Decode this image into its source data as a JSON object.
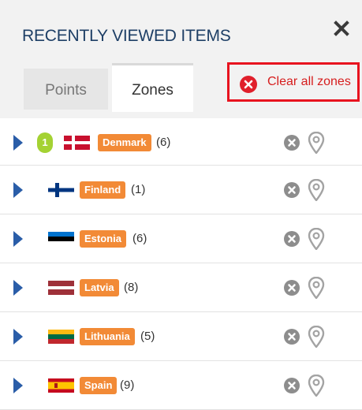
{
  "panel": {
    "title": "RECENTLY VIEWED ITEMS",
    "close_icon": "close-icon"
  },
  "tabs": [
    {
      "label": "Points",
      "active": false
    },
    {
      "label": "Zones",
      "active": true
    }
  ],
  "clear_button": {
    "label": "Clear all zones",
    "icon": "clear-circle-x-icon",
    "color": "#d61d1d"
  },
  "zones": [
    {
      "name": "Denmark",
      "count": "(6)",
      "level": "1",
      "flag": "denmark-flag-icon"
    },
    {
      "name": "Finland",
      "count": "(1)",
      "flag": "finland-flag-icon"
    },
    {
      "name": "Estonia",
      "count": "(6)",
      "flag": "estonia-flag-icon"
    },
    {
      "name": "Latvia",
      "count": "(8)",
      "flag": "latvia-flag-icon"
    },
    {
      "name": "Lithuania",
      "count": "(5)",
      "flag": "lithuania-flag-icon"
    },
    {
      "name": "Spain",
      "count": "(9)",
      "flag": "spain-flag-icon"
    }
  ],
  "colors": {
    "title": "#1e3f66",
    "tag": "#f28a36",
    "expander": "#2a5da8",
    "level_badge": "#a4d233",
    "highlight_border": "#e8131f"
  }
}
